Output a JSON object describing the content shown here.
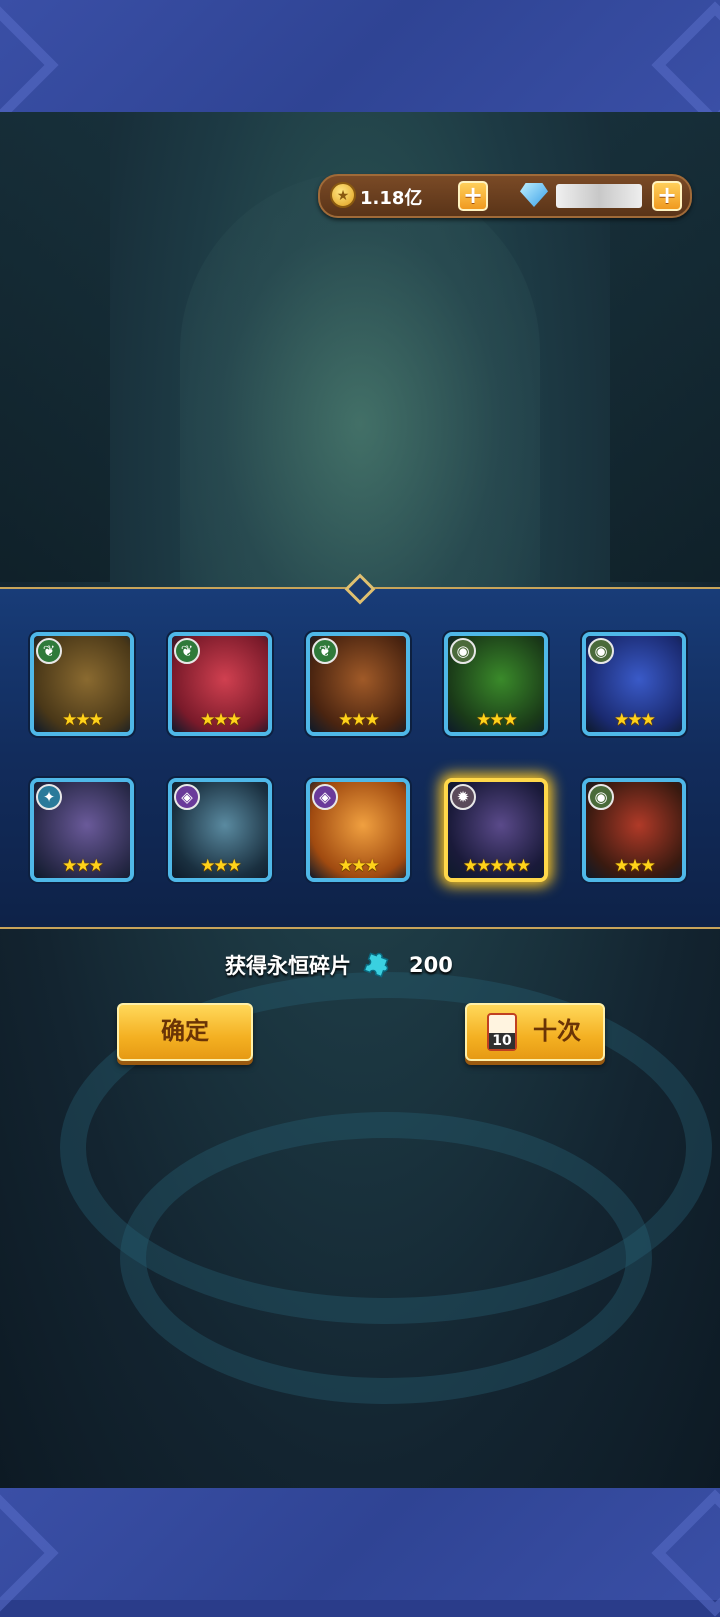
{
  "currency": {
    "gold_amount": "1.18亿",
    "gold_icon": "coin-icon",
    "gem_icon": "gem-icon",
    "plus_icon": "plus-icon",
    "gem_amount_hidden": true
  },
  "heroes": [
    {
      "element": "nature",
      "stars": 3,
      "highlight": false,
      "name_icon": "tree-golem-portrait"
    },
    {
      "element": "nature",
      "stars": 3,
      "highlight": false,
      "name_icon": "red-bird-portrait"
    },
    {
      "element": "nature",
      "stars": 3,
      "highlight": false,
      "name_icon": "werewolf-portrait"
    },
    {
      "element": "abyss",
      "stars": 3,
      "highlight": false,
      "name_icon": "green-rock-golem-portrait"
    },
    {
      "element": "abyss",
      "stars": 3,
      "highlight": false,
      "name_icon": "blue-cyclops-portrait"
    },
    {
      "element": "undead",
      "stars": 3,
      "highlight": false,
      "name_icon": "zombie-portrait"
    },
    {
      "element": "dark",
      "stars": 3,
      "highlight": false,
      "name_icon": "armored-knight-portrait"
    },
    {
      "element": "dark",
      "stars": 3,
      "highlight": false,
      "name_icon": "fire-spirit-portrait"
    },
    {
      "element": "chaos",
      "stars": 5,
      "highlight": true,
      "name_icon": "dark-beast-portrait"
    },
    {
      "element": "abyss",
      "stars": 3,
      "highlight": false,
      "name_icon": "red-orc-portrait"
    }
  ],
  "reward": {
    "label": "获得永恒碎片",
    "amount": "200",
    "icon": "puzzle-piece-icon"
  },
  "buttons": {
    "confirm_label": "确定",
    "ten_label": "十次",
    "ten_ticket_count": "10"
  },
  "colors": {
    "card_border": "#4fb8e8",
    "card_highlight": "#ffd84a",
    "button_fill": "#f4b022",
    "star": "#ffd21a"
  }
}
